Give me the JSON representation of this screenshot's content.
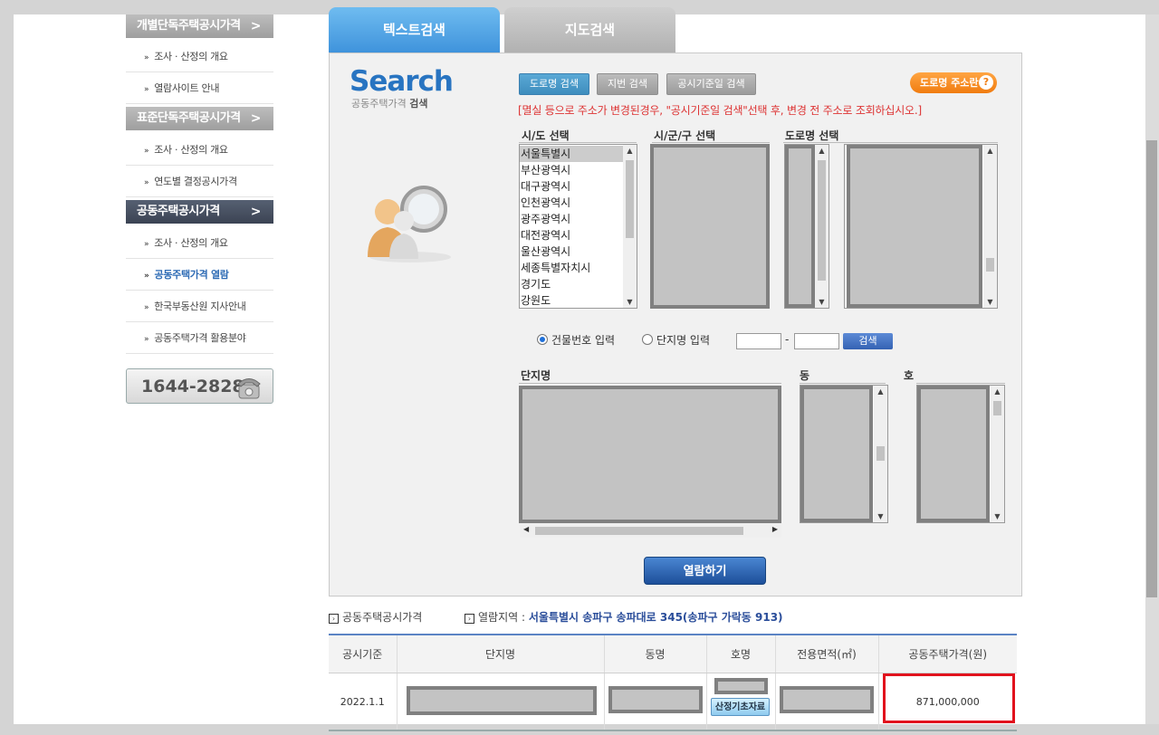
{
  "sidebar": {
    "sections": [
      {
        "title": "개별단독주택공시가격",
        "items": [
          "조사 · 산정의 개요",
          "열람사이트 안내"
        ]
      },
      {
        "title": "표준단독주택공시가격",
        "items": [
          "조사 · 산정의 개요",
          "연도별 결정공시가격"
        ]
      },
      {
        "title": "공동주택공시가격",
        "items": [
          "조사 · 산정의 개요",
          "공동주택가격 열람",
          "한국부동산원 지사안내",
          "공동주택가격 활용분야"
        ]
      }
    ],
    "chevron": ">",
    "bullet": "»",
    "phone": "1644-2828"
  },
  "tabs": {
    "text_search": "텍스트검색",
    "map_search": "지도검색"
  },
  "logo": {
    "title": "Search",
    "sub_prefix": "공동주택가격",
    "sub_bold": "검색"
  },
  "search_type_buttons": {
    "road": "도로명 검색",
    "lot": "지번 검색",
    "date": "공시기준일 검색"
  },
  "road_addr_button": {
    "label": "도로명 주소란",
    "help": "?"
  },
  "notice": "[멸실 등으로 주소가 변경된경우, \"공시기준일 검색\"선택 후, 변경 전 주소로 조회하십시오.]",
  "labels": {
    "sido": "시/도 선택",
    "sigungu": "시/군/구 선택",
    "road": "도로명 선택",
    "complex": "단지명",
    "dong": "동",
    "ho": "호"
  },
  "sido_options": [
    "서울특별시",
    "부산광역시",
    "대구광역시",
    "인천광역시",
    "광주광역시",
    "대전광역시",
    "울산광역시",
    "세종특별자치시",
    "경기도",
    "강원도"
  ],
  "sido_selected": "서울특별시",
  "radio": {
    "building_no": "건물번호 입력",
    "complex_name": "단지명 입력"
  },
  "dash": "-",
  "search_button": "검색",
  "view_button": "열람하기",
  "info": {
    "label1": "공동주택공시가격",
    "label2": "열람지역 :",
    "region": "서울특별시 송파구 송파대로 345(송파구 가락동 913)"
  },
  "table": {
    "headers": [
      "공시기준",
      "단지명",
      "동명",
      "호명",
      "전용면적(㎡)",
      "공동주택가격(원)"
    ],
    "rows": [
      {
        "date": "2022.1.1",
        "calc_button": "산정기초자료",
        "price": "871,000,000"
      }
    ]
  },
  "colors": {
    "tab_active": "#3f93dc",
    "accent_blue": "#2874c1",
    "notice_red": "#d33333",
    "highlight_red": "#e1121d",
    "road_btn_orange": "#f07c10"
  },
  "icons": [
    "search-person-icon",
    "phone-icon",
    "chevron-right-icon",
    "help-icon"
  ]
}
